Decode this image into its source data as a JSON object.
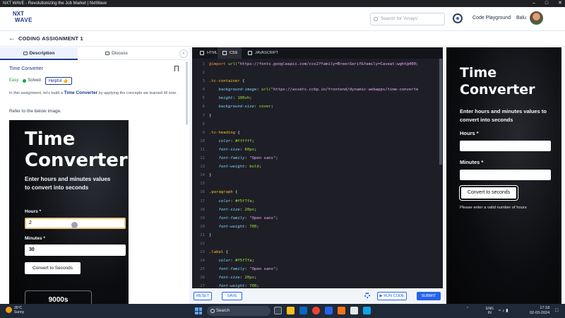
{
  "browser": {
    "title": "NXT WAVE - Revolutionizing the Job Market | NxtWave"
  },
  "header": {
    "logo_line1": "NXT",
    "logo_line2": "WAVE",
    "search_placeholder": "Search for 'Arrays'",
    "playground_label": "Code Playground",
    "user_name": "Balu"
  },
  "subheader": {
    "back_icon": "arrow-left-icon",
    "title": "CODING ASSIGNMENT 1"
  },
  "left_panel": {
    "tabs": [
      {
        "label": "Description",
        "icon": "document-icon",
        "active": true
      },
      {
        "label": "Discuss",
        "icon": "chat-icon",
        "active": false
      }
    ],
    "question_title": "Time Converter",
    "difficulty": "Easy",
    "status": "Solved",
    "helpful_label": "Helpful",
    "description_prefix": "In this assignment, let's build a",
    "description_highlight": "Time Converter",
    "description_suffix": "by applying the concepts we learned till now.",
    "refer_text": "Refer to the below image.",
    "preview": {
      "title": "Time Converter",
      "subtitle": "Enter hours and minutes values to convert into seconds",
      "hours_label": "Hours *",
      "hours_value": "2",
      "minutes_label": "Minutes *",
      "minutes_value": "30",
      "button_label": "Convert to Seconds",
      "result": "9000s"
    }
  },
  "editor": {
    "tabs": [
      {
        "label": "HTML",
        "active": false
      },
      {
        "label": "CSS",
        "active": true
      },
      {
        "label": "JAVASCRIPT",
        "active": false
      }
    ],
    "lines": [
      {
        "n": "1",
        "parts": [
          [
            "atr",
            "@import "
          ],
          [
            "val",
            "url("
          ],
          [
            "str",
            "\"https://fonts.googleapis.com/css2?family=Bree+Serif&family=Caveat:wght@400;"
          ]
        ]
      },
      {
        "n": "2",
        "parts": []
      },
      {
        "n": "3",
        "parts": [
          [
            "sel",
            ".tc-container"
          ],
          [
            "",
            " {"
          ]
        ]
      },
      {
        "n": "4",
        "parts": [
          [
            "prop",
            "    background-image"
          ],
          [
            "",
            ": "
          ],
          [
            "val",
            "url("
          ],
          [
            "str",
            "\"https://assets.ccbp.in/frontend/dynamic-webapps/time-converte"
          ]
        ]
      },
      {
        "n": "5",
        "parts": [
          [
            "prop",
            "    height"
          ],
          [
            "",
            ": "
          ],
          [
            "val",
            "100vh"
          ],
          [
            "",
            ";"
          ]
        ]
      },
      {
        "n": "6",
        "parts": [
          [
            "prop",
            "    background-size"
          ],
          [
            "",
            ": "
          ],
          [
            "val",
            "cover"
          ],
          [
            "",
            ";"
          ]
        ]
      },
      {
        "n": "7",
        "parts": [
          [
            "",
            "}"
          ]
        ]
      },
      {
        "n": "8",
        "parts": []
      },
      {
        "n": "9",
        "parts": [
          [
            "sel",
            ".tc-heading"
          ],
          [
            "",
            " {"
          ]
        ]
      },
      {
        "n": "10",
        "parts": [
          [
            "prop",
            "    color"
          ],
          [
            "",
            ": "
          ],
          [
            "val",
            "#ffffff"
          ],
          [
            "",
            ";"
          ]
        ]
      },
      {
        "n": "11",
        "parts": [
          [
            "prop",
            "    font-size"
          ],
          [
            "",
            ": "
          ],
          [
            "val",
            "60px"
          ],
          [
            "",
            ";"
          ]
        ]
      },
      {
        "n": "12",
        "parts": [
          [
            "prop",
            "    font-family"
          ],
          [
            "",
            ": "
          ],
          [
            "str",
            "\"Open sans\""
          ],
          [
            "",
            ";"
          ]
        ]
      },
      {
        "n": "13",
        "parts": [
          [
            "prop",
            "    font-weight"
          ],
          [
            "",
            ": "
          ],
          [
            "val",
            "bold"
          ],
          [
            "",
            ";"
          ]
        ]
      },
      {
        "n": "14",
        "parts": [
          [
            "",
            "}"
          ]
        ]
      },
      {
        "n": "15",
        "parts": []
      },
      {
        "n": "16",
        "parts": [
          [
            "sel",
            ".paragraph"
          ],
          [
            "",
            " {"
          ]
        ]
      },
      {
        "n": "17",
        "parts": [
          [
            "prop",
            "    color"
          ],
          [
            "",
            ": "
          ],
          [
            "val",
            "#f5f7fa"
          ],
          [
            "",
            ";"
          ]
        ]
      },
      {
        "n": "18",
        "parts": [
          [
            "prop",
            "    font-size"
          ],
          [
            "",
            ": "
          ],
          [
            "val",
            "20px"
          ],
          [
            "",
            ";"
          ]
        ]
      },
      {
        "n": "19",
        "parts": [
          [
            "prop",
            "    font-family"
          ],
          [
            "",
            ": "
          ],
          [
            "str",
            "\"Open sans\""
          ],
          [
            "",
            ";"
          ]
        ]
      },
      {
        "n": "20",
        "parts": [
          [
            "prop",
            "    font-weight"
          ],
          [
            "",
            ": "
          ],
          [
            "val",
            "700"
          ],
          [
            "",
            ";"
          ]
        ]
      },
      {
        "n": "21",
        "parts": [
          [
            "",
            "}"
          ]
        ]
      },
      {
        "n": "22",
        "parts": []
      },
      {
        "n": "23",
        "parts": [
          [
            "sel",
            ".label"
          ],
          [
            "",
            " {"
          ]
        ]
      },
      {
        "n": "24",
        "parts": [
          [
            "prop",
            "    color"
          ],
          [
            "",
            ": "
          ],
          [
            "val",
            "#f5f7fa"
          ],
          [
            "",
            ";"
          ]
        ]
      },
      {
        "n": "25",
        "parts": [
          [
            "prop",
            "    font-family"
          ],
          [
            "",
            ": "
          ],
          [
            "str",
            "\"Open sans\""
          ],
          [
            "",
            ";"
          ]
        ]
      },
      {
        "n": "26",
        "parts": [
          [
            "prop",
            "    font-size"
          ],
          [
            "",
            ": "
          ],
          [
            "val",
            "20px"
          ],
          [
            "",
            ";"
          ]
        ]
      },
      {
        "n": "27",
        "parts": [
          [
            "prop",
            "    font-weight"
          ],
          [
            "",
            ": "
          ],
          [
            "val",
            "700"
          ],
          [
            "",
            ";"
          ]
        ]
      }
    ],
    "buttons": {
      "reset": "RESET",
      "save": "SAVE",
      "run": "RUN CODE",
      "submit": "SUBMIT"
    }
  },
  "output": {
    "title": "Time Converter",
    "subtitle": "Enter hours and minutes values to convert into seconds",
    "hours_label": "Hours *",
    "minutes_label": "Minutes *",
    "button_label": "Convert to seconds",
    "error": "Please enter a valid number of hours"
  },
  "taskbar": {
    "temperature": "35°C",
    "weather": "Sunny",
    "search_label": "Search",
    "lang_top": "ENG",
    "lang_bottom": "IN",
    "time": "17:18",
    "date": "02-03-2024"
  }
}
